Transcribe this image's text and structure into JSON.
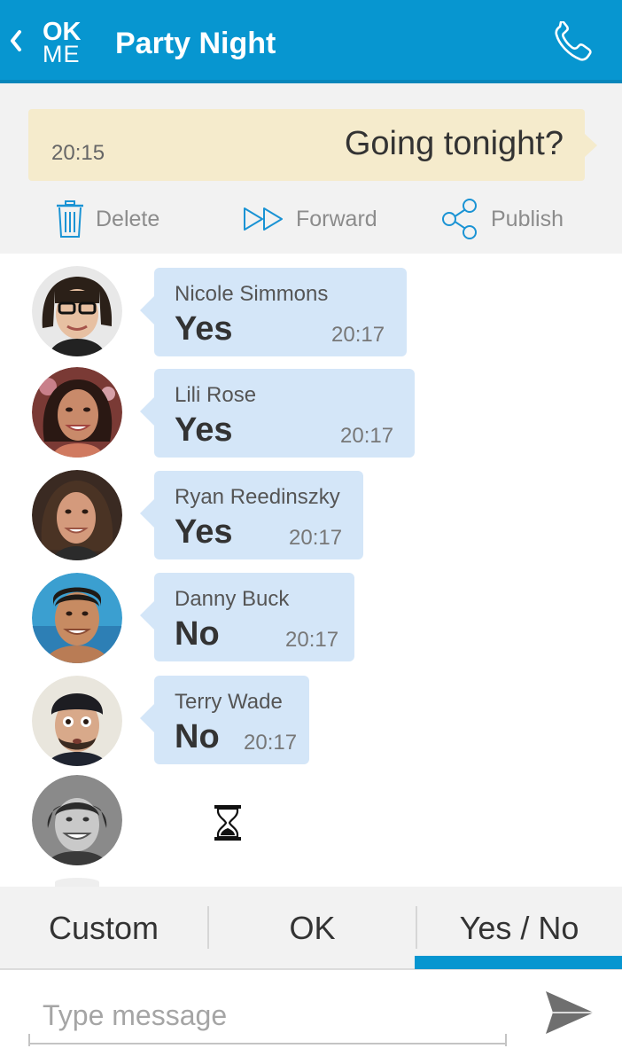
{
  "header": {
    "logo_top": "OK",
    "logo_bottom": "ME",
    "title": "Party Night",
    "back_icon": "chevron-left-icon",
    "call_icon": "phone-icon",
    "background_color": "#0796d0"
  },
  "question": {
    "time": "20:15",
    "text": "Going tonight?",
    "background_color": "#f5ebcc"
  },
  "actions": [
    {
      "label": "Delete",
      "icon": "trash-icon"
    },
    {
      "label": "Forward",
      "icon": "forward-icon"
    },
    {
      "label": "Publish",
      "icon": "share-icon"
    }
  ],
  "responses": [
    {
      "name": "Nicole Simmons",
      "answer": "Yes",
      "time": "20:17"
    },
    {
      "name": "Lili Rose",
      "answer": "Yes",
      "time": "20:17"
    },
    {
      "name": "Ryan Reedinszky",
      "answer": "Yes",
      "time": "20:17"
    },
    {
      "name": "Danny Buck",
      "answer": "No",
      "time": "20:17"
    },
    {
      "name": "Terry Wade",
      "answer": "No",
      "time": "20:17"
    }
  ],
  "pending": {
    "icon": "hourglass-icon"
  },
  "reply_tabs": [
    {
      "label": "Custom",
      "selected": false
    },
    {
      "label": "OK",
      "selected": false
    },
    {
      "label": "Yes / No",
      "selected": true
    }
  ],
  "compose": {
    "placeholder": "Type message",
    "value": "",
    "send_icon": "send-icon"
  },
  "colors": {
    "accent": "#0796d0",
    "bubble": "#d4e6f8"
  }
}
